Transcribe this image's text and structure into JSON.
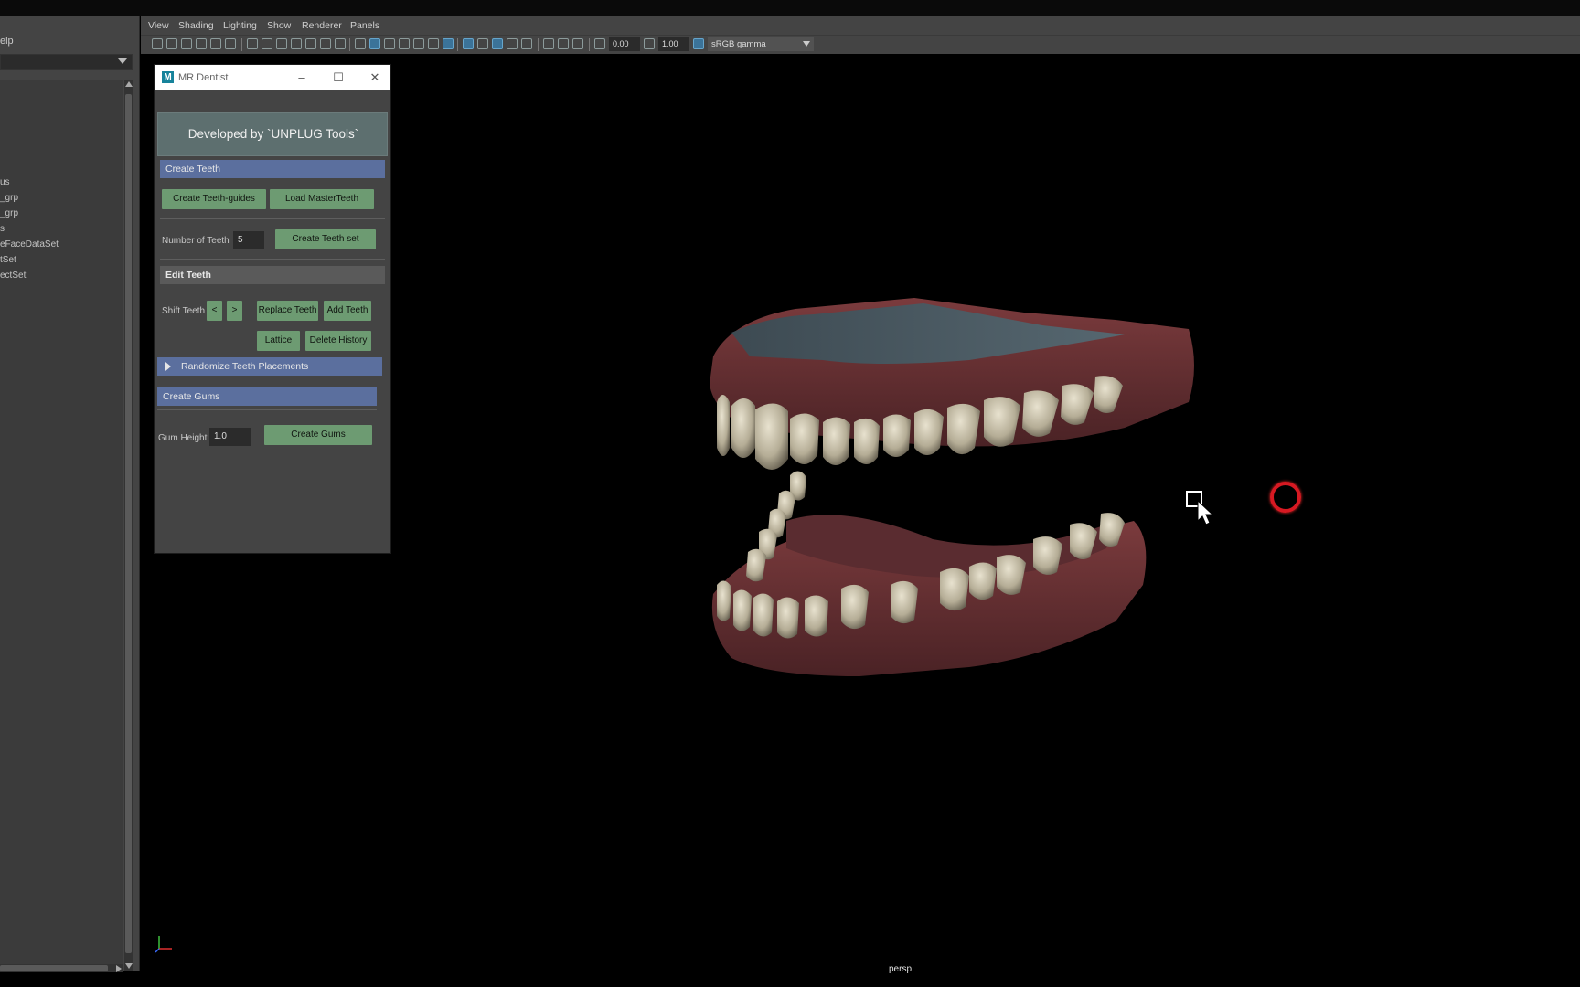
{
  "outliner": {
    "help_label": "elp",
    "items": [
      "us",
      "_grp",
      "_grp",
      "s",
      "eFaceDataSet",
      "tSet",
      "ectSet"
    ]
  },
  "viewport": {
    "menu": [
      "View",
      "Shading",
      "Lighting",
      "Show",
      "Renderer",
      "Panels"
    ],
    "toolbar": {
      "field_a": "0.00",
      "field_b": "1.00",
      "color_space": "sRGB gamma"
    },
    "camera_label": "persp"
  },
  "window": {
    "title": "MR Dentist",
    "app_icon": "M",
    "banner": "Developed by `UNPLUG Tools`",
    "create_teeth_header": "Create Teeth",
    "create_guides_btn": "Create Teeth-guides",
    "load_master_btn": "Load MasterTeeth",
    "num_teeth_label": "Number of Teeth",
    "num_teeth_value": "5",
    "create_set_btn": "Create Teeth set",
    "edit_teeth_header": "Edit Teeth",
    "shift_label": "Shift Teeth",
    "shift_left": "<",
    "shift_right": ">",
    "replace_btn": "Replace Teeth",
    "add_btn": "Add Teeth",
    "lattice_btn": "Lattice",
    "delete_history_btn": "Delete History",
    "randomize_header": "Randomize Teeth Placements",
    "create_gums_header": "Create Gums",
    "gum_height_label": "Gum Height",
    "gum_height_value": "1.0",
    "create_gums_btn": "Create Gums"
  },
  "colors": {
    "button_green": "#6d9b72",
    "section_blue": "#5b6f9e",
    "record_red": "#d71922"
  },
  "icons": [
    "camera-icon",
    "grid-icon",
    "shaded-cube-icon",
    "light-icon",
    "gamma-icon",
    "close-icon",
    "maximize-icon",
    "minimize-icon",
    "cursor-icon",
    "record-indicator-icon",
    "axis-gizmo-icon"
  ]
}
